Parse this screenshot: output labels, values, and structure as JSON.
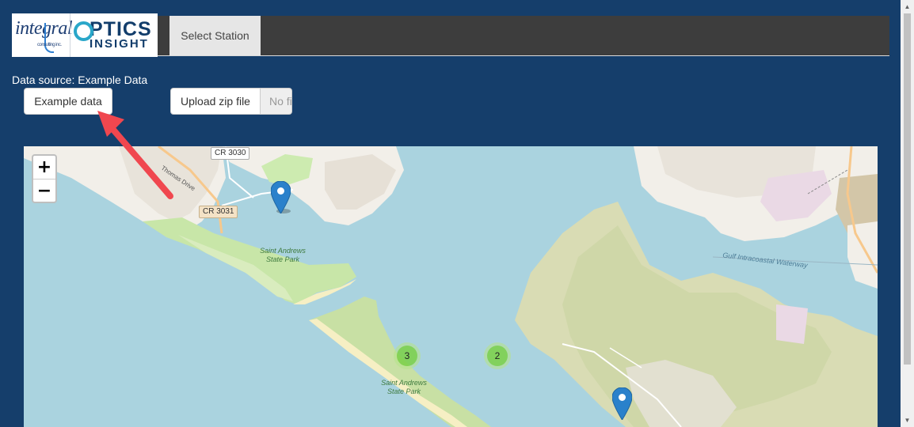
{
  "header": {
    "logo_integral": "integral",
    "logo_integral_sub": "consulting inc.",
    "logo_optics": "PTICS",
    "logo_insight": "INSIGHT",
    "tabs": [
      {
        "label": "Select Station"
      }
    ]
  },
  "data_source": {
    "label": "Data source: Example Data"
  },
  "buttons": {
    "example_label": "Example data",
    "upload_label": "Upload zip file",
    "file_status": "No file selected"
  },
  "map": {
    "zoom_in": "+",
    "zoom_out": "−",
    "road_labels": [
      "CR 3030",
      "CR 3031"
    ],
    "street_label": "Thomas Drive",
    "park_labels": [
      "Saint Andrews State Park",
      "Saint Andrews State Park"
    ],
    "waterway_label": "Gulf Intracoastal Waterway",
    "clusters": [
      {
        "count": "3"
      },
      {
        "count": "2"
      }
    ],
    "markers": [
      "location-marker",
      "location-marker"
    ]
  },
  "colors": {
    "page_bg": "#153e6b",
    "navbar_bg": "#3d3d3d",
    "water": "#aad3df",
    "annotation_arrow": "#f0474f"
  }
}
